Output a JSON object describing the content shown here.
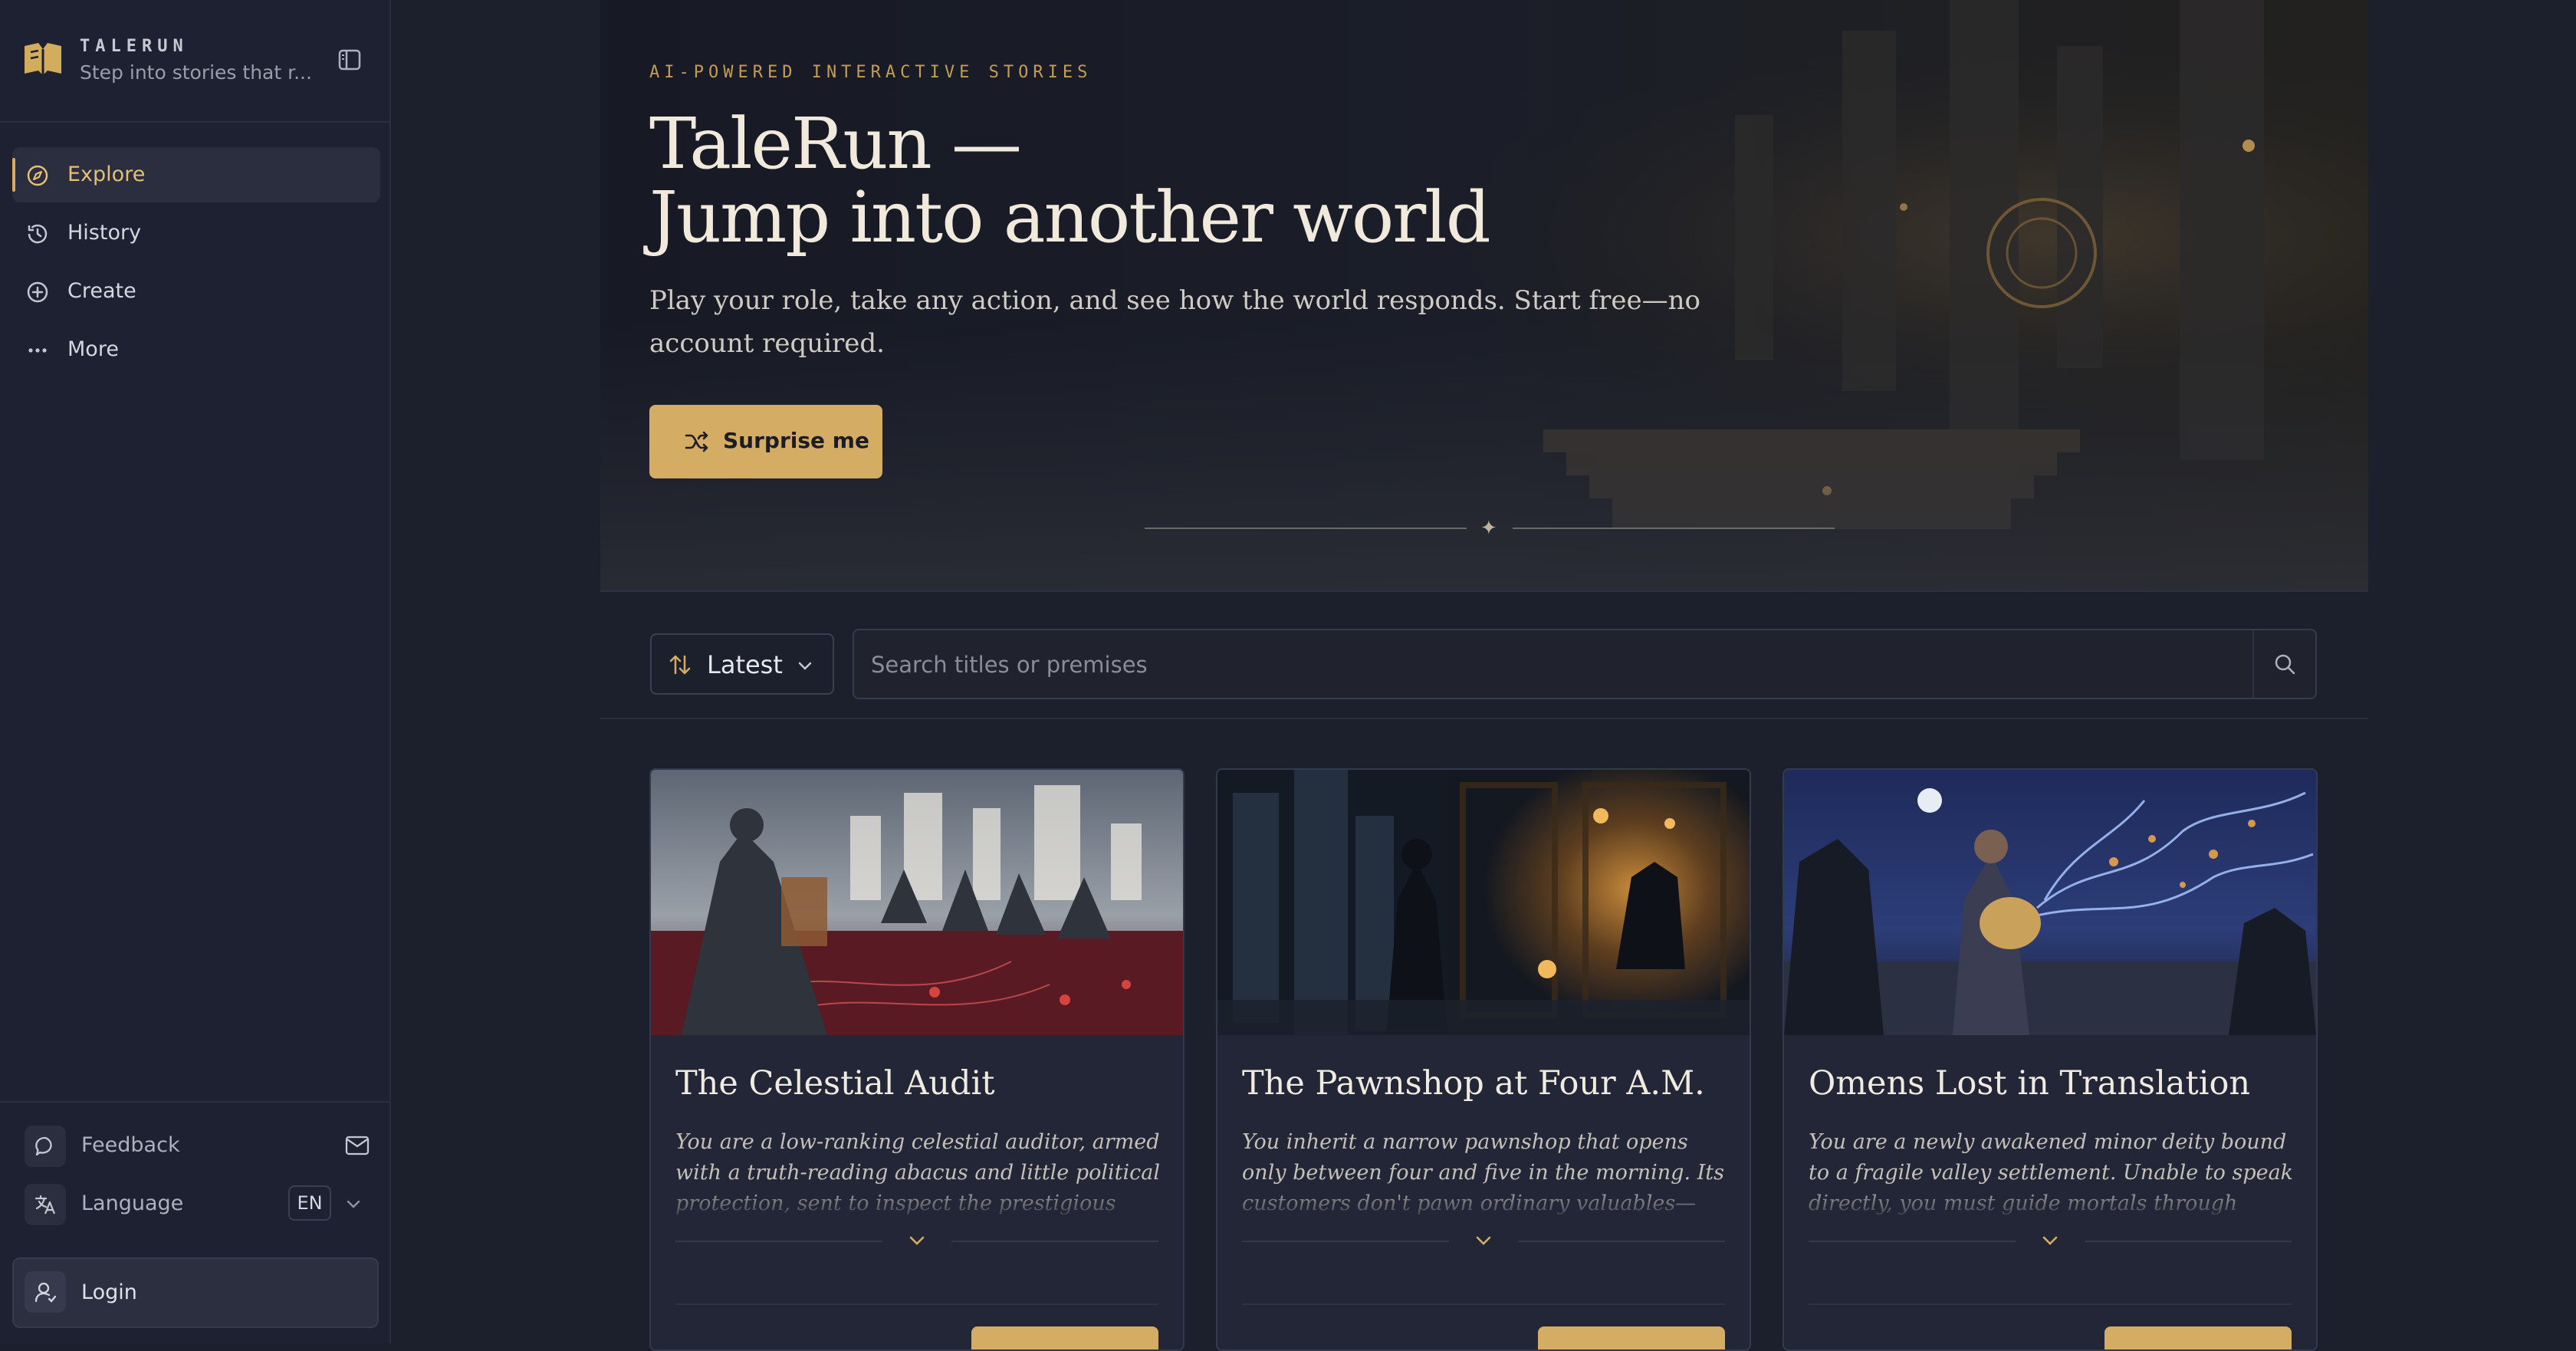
{
  "sidebar": {
    "brand_name": "TALERUN",
    "brand_tagline": "Step into stories that r...",
    "nav": [
      {
        "label": "Explore",
        "icon": "compass-icon",
        "active": true
      },
      {
        "label": "History",
        "icon": "history-icon",
        "active": false
      },
      {
        "label": "Create",
        "icon": "plus-circle-icon",
        "active": false
      },
      {
        "label": "More",
        "icon": "ellipsis-icon",
        "active": false
      }
    ],
    "feedback_label": "Feedback",
    "language_label": "Language",
    "language_value": "EN",
    "login_label": "Login"
  },
  "hero": {
    "kicker": "AI-POWERED INTERACTIVE STORIES",
    "title_line1": "TaleRun —",
    "title_line2": "Jump into another world",
    "description": "Play your role, take any action, and see how the world responds. Start free—no account required.",
    "cta_label": "Surprise me"
  },
  "toolbar": {
    "sort_label": "Latest",
    "search_placeholder": "Search titles or premises"
  },
  "stories": [
    {
      "title": "The Celestial Audit",
      "description": "You are a low-ranking celestial auditor, armed with a truth-reading abacus and little political protection, sent to inspect the prestigious"
    },
    {
      "title": "The Pawnshop at Four A.M.",
      "description": "You inherit a narrow pawnshop that opens only between four and five in the morning. Its customers don't pawn ordinary valuables—they offer a"
    },
    {
      "title": "Omens Lost in Translation",
      "description": "You are a newly awakened minor deity bound to a fragile valley settlement. Unable to speak directly, you must guide mortals through indirect omens:"
    }
  ],
  "colors": {
    "accent": "#d4ac63",
    "sidebar_bg": "#1d2132",
    "page_bg": "#1c1f2c",
    "card_bg": "#222636"
  }
}
